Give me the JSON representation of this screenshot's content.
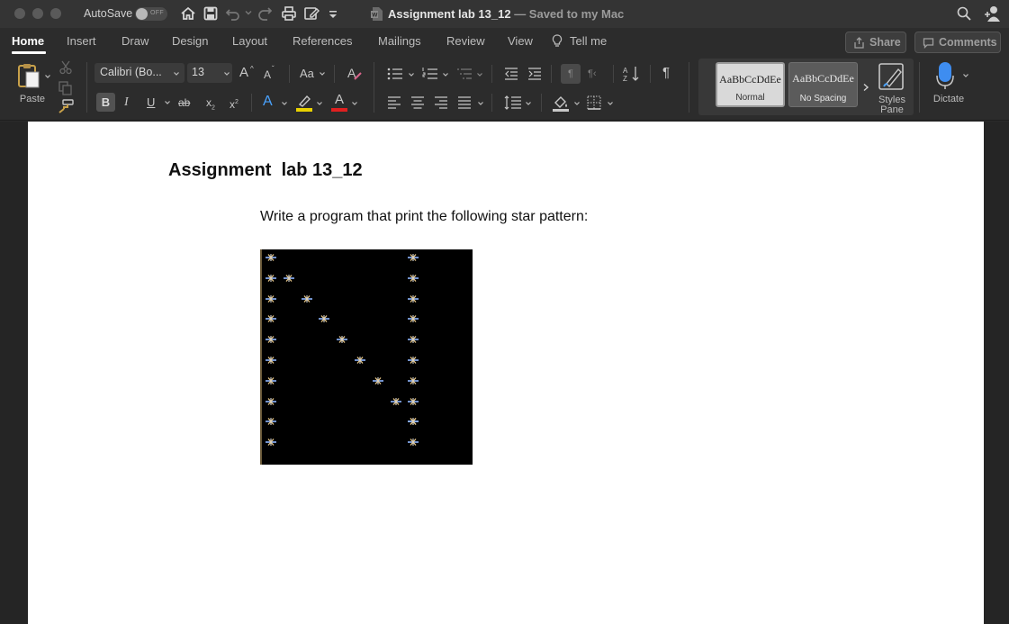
{
  "titlebar": {
    "autosave_label": "AutoSave",
    "autosave_state": "OFF",
    "doc_name": "Assignment  lab 13_12",
    "doc_status": "— Saved to my Mac"
  },
  "tabs": [
    {
      "label": "Home",
      "active": true
    },
    {
      "label": "Insert"
    },
    {
      "label": "Draw"
    },
    {
      "label": "Design"
    },
    {
      "label": "Layout"
    },
    {
      "label": "References"
    },
    {
      "label": "Mailings"
    },
    {
      "label": "Review"
    },
    {
      "label": "View"
    },
    {
      "label": "Tell me"
    }
  ],
  "top_buttons": {
    "share": "Share",
    "comments": "Comments"
  },
  "toolbar": {
    "paste_label": "Paste",
    "font_name": "Calibri (Bo...",
    "font_size": "13",
    "bold": "B",
    "italic": "I",
    "underline": "U",
    "strike": "ab",
    "subscript": "x",
    "superscript": "x",
    "grow_font": "A",
    "shrink_font": "A",
    "change_case": "Aa",
    "font_color_letter": "A",
    "text_effects_letter": "A",
    "styles": [
      {
        "sample": "AaBbCcDdEe",
        "name": "Normal",
        "selected": true
      },
      {
        "sample": "AaBbCcDdEe",
        "name": "No Spacing"
      }
    ],
    "styles_pane_label_1": "Styles",
    "styles_pane_label_2": "Pane",
    "dictate_label": "Dictate"
  },
  "document": {
    "heading": "Assignment  lab 13_12",
    "body": "Write a program that print the following star pattern:"
  },
  "colors": {
    "title_bar": "#343434",
    "ribbon": "#2c2c2c",
    "highlight_yellow": "#e8d100",
    "font_red": "#e02020",
    "text_effect_blue": "#4aa3ff",
    "dictate_blue": "#3e8df0"
  },
  "star_pattern": {
    "rows": [
      [
        0,
        8
      ],
      [
        0,
        1,
        8
      ],
      [
        0,
        2,
        8
      ],
      [
        0,
        3,
        8
      ],
      [
        0,
        4,
        8
      ],
      [
        0,
        5,
        8
      ],
      [
        0,
        6,
        8
      ],
      [
        0,
        7,
        8
      ],
      [
        0,
        8,
        8
      ],
      [
        0,
        8
      ]
    ]
  }
}
